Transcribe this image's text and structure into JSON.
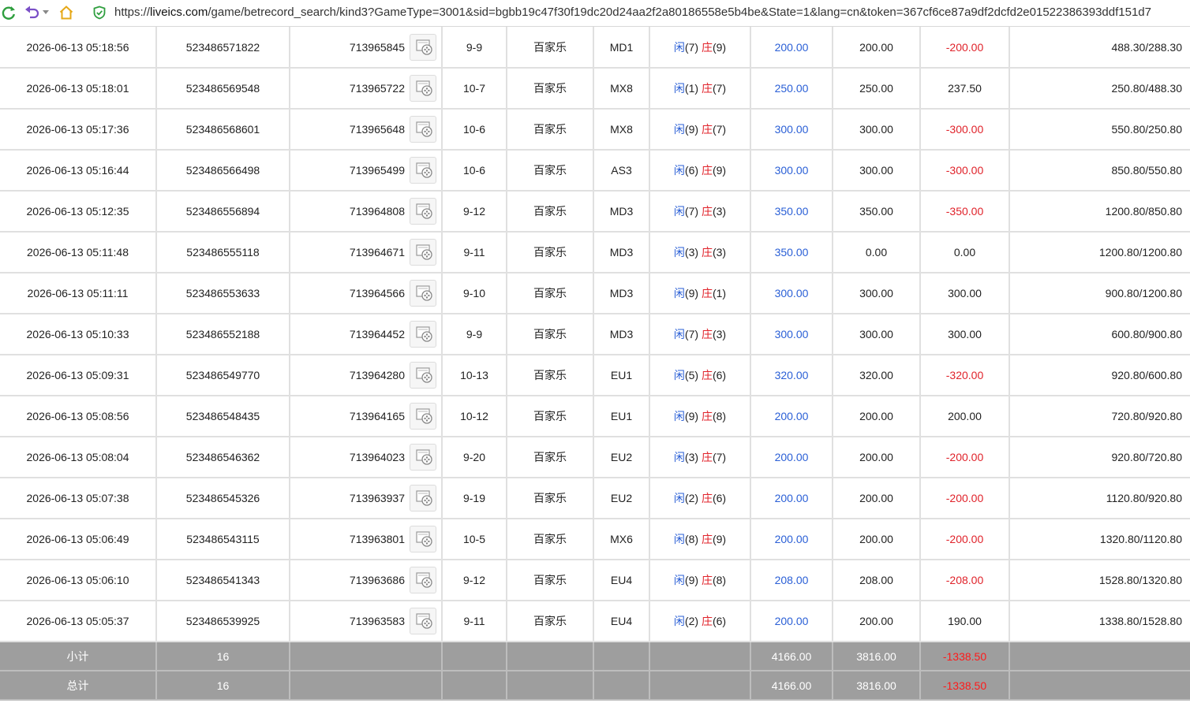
{
  "browser": {
    "url_scheme": "https://",
    "url_host": "liveics.com",
    "url_path": "/game/betrecord_search/kind3?GameType=3001&sid=bgbb19c47f30f19dc20d24aa2f2a80186558e5b4be&State=1&lang=cn&token=367cf6ce87a9df2dcfd2e01522386393ddf151d7"
  },
  "rows": [
    {
      "time": "2026-06-13 05:18:56",
      "bet_no": "523486571822",
      "round": "713965845",
      "shoe": "9-9",
      "game": "百家乐",
      "table": "MD1",
      "p_label": "闲",
      "p_val": "(7)",
      "b_label": "庄",
      "b_val": "(9)",
      "bet": "200.00",
      "valid": "200.00",
      "win": "-200.00",
      "win_neg": true,
      "balance": "488.30/288.30"
    },
    {
      "time": "2026-06-13 05:18:01",
      "bet_no": "523486569548",
      "round": "713965722",
      "shoe": "10-7",
      "game": "百家乐",
      "table": "MX8",
      "p_label": "闲",
      "p_val": "(1)",
      "b_label": "庄",
      "b_val": "(7)",
      "bet": "250.00",
      "valid": "250.00",
      "win": "237.50",
      "win_neg": false,
      "balance": "250.80/488.30"
    },
    {
      "time": "2026-06-13 05:17:36",
      "bet_no": "523486568601",
      "round": "713965648",
      "shoe": "10-6",
      "game": "百家乐",
      "table": "MX8",
      "p_label": "闲",
      "p_val": "(9)",
      "b_label": "庄",
      "b_val": "(7)",
      "bet": "300.00",
      "valid": "300.00",
      "win": "-300.00",
      "win_neg": true,
      "balance": "550.80/250.80"
    },
    {
      "time": "2026-06-13 05:16:44",
      "bet_no": "523486566498",
      "round": "713965499",
      "shoe": "10-6",
      "game": "百家乐",
      "table": "AS3",
      "p_label": "闲",
      "p_val": "(6)",
      "b_label": "庄",
      "b_val": "(9)",
      "bet": "300.00",
      "valid": "300.00",
      "win": "-300.00",
      "win_neg": true,
      "balance": "850.80/550.80"
    },
    {
      "time": "2026-06-13 05:12:35",
      "bet_no": "523486556894",
      "round": "713964808",
      "shoe": "9-12",
      "game": "百家乐",
      "table": "MD3",
      "p_label": "闲",
      "p_val": "(7)",
      "b_label": "庄",
      "b_val": "(3)",
      "bet": "350.00",
      "valid": "350.00",
      "win": "-350.00",
      "win_neg": true,
      "balance": "1200.80/850.80"
    },
    {
      "time": "2026-06-13 05:11:48",
      "bet_no": "523486555118",
      "round": "713964671",
      "shoe": "9-11",
      "game": "百家乐",
      "table": "MD3",
      "p_label": "闲",
      "p_val": "(3)",
      "b_label": "庄",
      "b_val": "(3)",
      "bet": "350.00",
      "valid": "0.00",
      "win": "0.00",
      "win_neg": false,
      "balance": "1200.80/1200.80"
    },
    {
      "time": "2026-06-13 05:11:11",
      "bet_no": "523486553633",
      "round": "713964566",
      "shoe": "9-10",
      "game": "百家乐",
      "table": "MD3",
      "p_label": "闲",
      "p_val": "(9)",
      "b_label": "庄",
      "b_val": "(1)",
      "bet": "300.00",
      "valid": "300.00",
      "win": "300.00",
      "win_neg": false,
      "balance": "900.80/1200.80"
    },
    {
      "time": "2026-06-13 05:10:33",
      "bet_no": "523486552188",
      "round": "713964452",
      "shoe": "9-9",
      "game": "百家乐",
      "table": "MD3",
      "p_label": "闲",
      "p_val": "(7)",
      "b_label": "庄",
      "b_val": "(3)",
      "bet": "300.00",
      "valid": "300.00",
      "win": "300.00",
      "win_neg": false,
      "balance": "600.80/900.80"
    },
    {
      "time": "2026-06-13 05:09:31",
      "bet_no": "523486549770",
      "round": "713964280",
      "shoe": "10-13",
      "game": "百家乐",
      "table": "EU1",
      "p_label": "闲",
      "p_val": "(5)",
      "b_label": "庄",
      "b_val": "(6)",
      "bet": "320.00",
      "valid": "320.00",
      "win": "-320.00",
      "win_neg": true,
      "balance": "920.80/600.80"
    },
    {
      "time": "2026-06-13 05:08:56",
      "bet_no": "523486548435",
      "round": "713964165",
      "shoe": "10-12",
      "game": "百家乐",
      "table": "EU1",
      "p_label": "闲",
      "p_val": "(9)",
      "b_label": "庄",
      "b_val": "(8)",
      "bet": "200.00",
      "valid": "200.00",
      "win": "200.00",
      "win_neg": false,
      "balance": "720.80/920.80"
    },
    {
      "time": "2026-06-13 05:08:04",
      "bet_no": "523486546362",
      "round": "713964023",
      "shoe": "9-20",
      "game": "百家乐",
      "table": "EU2",
      "p_label": "闲",
      "p_val": "(3)",
      "b_label": "庄",
      "b_val": "(7)",
      "bet": "200.00",
      "valid": "200.00",
      "win": "-200.00",
      "win_neg": true,
      "balance": "920.80/720.80"
    },
    {
      "time": "2026-06-13 05:07:38",
      "bet_no": "523486545326",
      "round": "713963937",
      "shoe": "9-19",
      "game": "百家乐",
      "table": "EU2",
      "p_label": "闲",
      "p_val": "(2)",
      "b_label": "庄",
      "b_val": "(6)",
      "bet": "200.00",
      "valid": "200.00",
      "win": "-200.00",
      "win_neg": true,
      "balance": "1120.80/920.80"
    },
    {
      "time": "2026-06-13 05:06:49",
      "bet_no": "523486543115",
      "round": "713963801",
      "shoe": "10-5",
      "game": "百家乐",
      "table": "MX6",
      "p_label": "闲",
      "p_val": "(8)",
      "b_label": "庄",
      "b_val": "(9)",
      "bet": "200.00",
      "valid": "200.00",
      "win": "-200.00",
      "win_neg": true,
      "balance": "1320.80/1120.80"
    },
    {
      "time": "2026-06-13 05:06:10",
      "bet_no": "523486541343",
      "round": "713963686",
      "shoe": "9-12",
      "game": "百家乐",
      "table": "EU4",
      "p_label": "闲",
      "p_val": "(9)",
      "b_label": "庄",
      "b_val": "(8)",
      "bet": "208.00",
      "valid": "208.00",
      "win": "-208.00",
      "win_neg": true,
      "balance": "1528.80/1320.80"
    },
    {
      "time": "2026-06-13 05:05:37",
      "bet_no": "523486539925",
      "round": "713963583",
      "shoe": "9-11",
      "game": "百家乐",
      "table": "EU4",
      "p_label": "闲",
      "p_val": "(2)",
      "b_label": "庄",
      "b_val": "(6)",
      "bet": "200.00",
      "valid": "200.00",
      "win": "190.00",
      "win_neg": false,
      "balance": "1338.80/1528.80"
    }
  ],
  "subtotal": {
    "label": "小计",
    "count": "16",
    "bet": "4166.00",
    "valid": "3816.00",
    "win": "-1338.50"
  },
  "total": {
    "label": "总计",
    "count": "16",
    "bet": "4166.00",
    "valid": "3816.00",
    "win": "-1338.50"
  },
  "colors": {
    "blue": "#2a5fd6",
    "red": "#e0222a",
    "summary_bg": "#9e9e9e"
  },
  "icons": {
    "refresh": "refresh-icon",
    "undo": "undo-icon",
    "home": "home-icon",
    "secure": "shield-check-icon",
    "replay": "video-replay-icon"
  }
}
